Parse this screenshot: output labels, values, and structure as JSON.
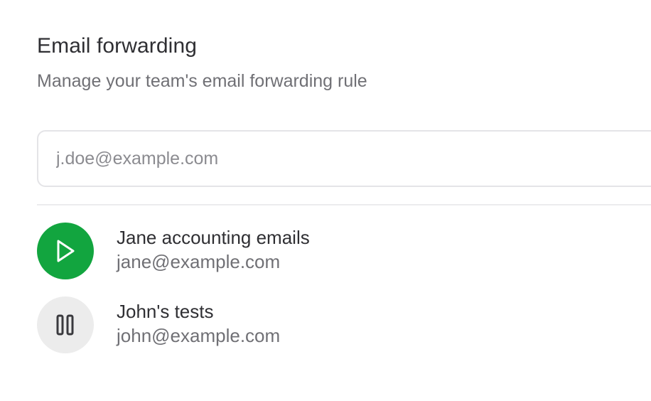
{
  "header": {
    "title": "Email forwarding",
    "subtitle": "Manage your team's email forwarding rule"
  },
  "email_input": {
    "value": "",
    "placeholder": "j.doe@example.com"
  },
  "rules": [
    {
      "name": "Jane accounting emails",
      "email": "jane@example.com",
      "state": "active",
      "icon": "play-icon",
      "color": "#12a53f"
    },
    {
      "name": "John's tests",
      "email": "john@example.com",
      "state": "paused",
      "icon": "pause-icon",
      "color": "#ececec"
    }
  ],
  "colors": {
    "accent_green": "#12a53f",
    "text_primary": "#2f2f33",
    "text_secondary": "#707075"
  }
}
